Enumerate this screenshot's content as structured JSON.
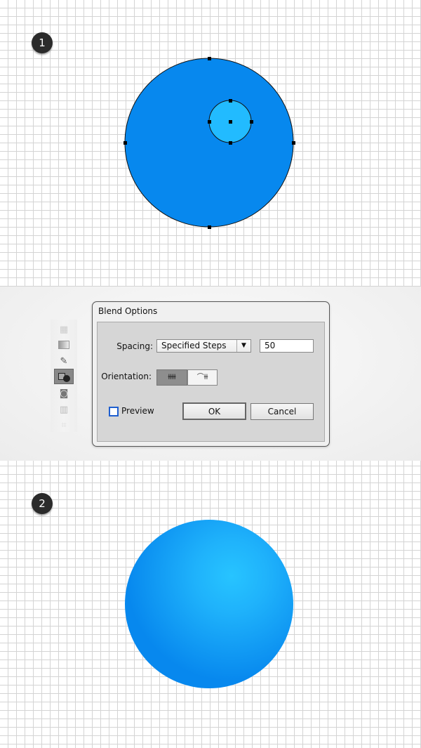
{
  "steps": [
    "1",
    "2"
  ],
  "dialog": {
    "title": "Blend Options",
    "spacing_label": "Spacing:",
    "spacing_value": "Specified Steps",
    "steps_value": "50",
    "orientation_label": "Orientation:",
    "orientation_selected": "align-to-page",
    "preview_label": "Preview",
    "preview_checked": false,
    "ok_label": "OK",
    "cancel_label": "Cancel"
  },
  "toolbar": {
    "items": [
      "mesh-tool",
      "gradient-tool",
      "eyedropper-tool",
      "blend-tool",
      "symbol-sprayer-tool",
      "graph-tool",
      "artboard-tool"
    ],
    "active": "blend-tool"
  },
  "colors": {
    "big_circle": "#0788ee",
    "small_circle": "#22bbff",
    "highlight": "#27c4ff"
  }
}
